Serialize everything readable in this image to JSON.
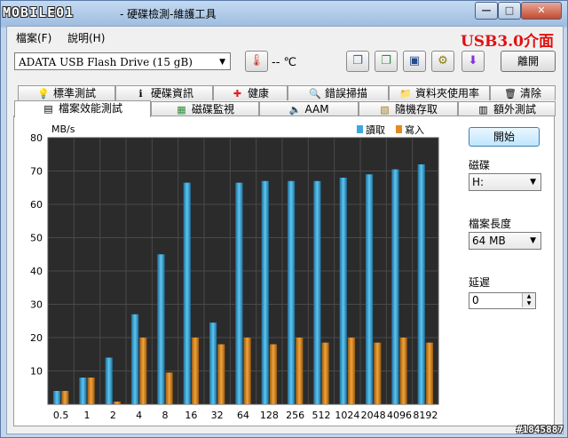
{
  "window": {
    "logo": "MOBILE01",
    "title": "- 硬碟檢測-維護工具",
    "controls": {
      "minimize": "—",
      "maximize": "□",
      "close": "✕"
    }
  },
  "menu": {
    "file": "檔案(F)",
    "help": "說明(H)"
  },
  "promo": "USB3.0介面",
  "toolbar": {
    "drive": "ADATA   USB Flash Drive  (15 gB)",
    "temperature": "-- ℃",
    "exit": "離開"
  },
  "tabs_top": [
    {
      "label": "標準測試",
      "icon": "bulb-icon",
      "glyph": "💡"
    },
    {
      "label": "硬碟資訊",
      "icon": "info-icon",
      "glyph": "ℹ"
    },
    {
      "label": "健康",
      "icon": "health-cross-icon",
      "glyph": "✚"
    },
    {
      "label": "錯誤掃描",
      "icon": "magnifier-icon",
      "glyph": "🔍"
    },
    {
      "label": "資料夾使用率",
      "icon": "folder-icon",
      "glyph": "📁"
    },
    {
      "label": "清除",
      "icon": "trash-icon",
      "glyph": "🗑"
    }
  ],
  "tabs_bottom": [
    {
      "label": "檔案效能測試",
      "icon": "file-icon",
      "glyph": "▤"
    },
    {
      "label": "磁碟監視",
      "icon": "monitor-icon",
      "glyph": "▦"
    },
    {
      "label": "AAM",
      "icon": "speaker-icon",
      "glyph": "🔈"
    },
    {
      "label": "隨機存取",
      "icon": "random-icon",
      "glyph": "▧"
    },
    {
      "label": "額外測試",
      "icon": "extra-icon",
      "glyph": "▥"
    }
  ],
  "side": {
    "start": "開始",
    "disk_label": "磁碟",
    "disk_value": "H:",
    "length_label": "檔案長度",
    "length_value": "64 MB",
    "delay_label": "延遲",
    "delay_value": "0"
  },
  "chart_data": {
    "type": "bar",
    "ylabel": "MB/s",
    "ylim": [
      0,
      80
    ],
    "yticks": [
      10,
      20,
      30,
      40,
      50,
      60,
      70,
      80
    ],
    "categories": [
      "0.5",
      "1",
      "2",
      "4",
      "8",
      "16",
      "32",
      "64",
      "128",
      "256",
      "512",
      "1024",
      "2048",
      "4096",
      "8192"
    ],
    "series": [
      {
        "name": "讀取",
        "color": "#3aa9e0",
        "values": [
          4,
          8,
          14,
          27,
          45,
          66.5,
          24.5,
          66.5,
          67,
          67,
          67,
          68,
          69,
          70.5,
          72
        ]
      },
      {
        "name": "寫入",
        "color": "#e28a1f",
        "values": [
          4,
          8,
          0.8,
          20,
          9.5,
          20,
          18,
          20,
          18,
          20,
          18.5,
          20,
          18.5,
          20,
          18.5
        ]
      }
    ],
    "grid": true,
    "legend": "top-right"
  },
  "watermark": "#1845887"
}
